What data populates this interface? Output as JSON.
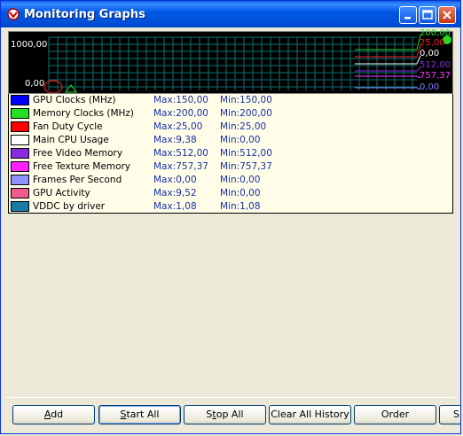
{
  "window": {
    "title": "Monitoring Graphs"
  },
  "graph": {
    "y_max_label": "1000,00",
    "y_min_label": "0,00",
    "right_values": [
      {
        "text": "200,00",
        "color": "#22dd22"
      },
      {
        "text": "25,00",
        "color": "#ff2020"
      },
      {
        "text": "0,00",
        "color": "#ffffff"
      },
      {
        "text": "512,00",
        "color": "#8a2be2"
      },
      {
        "text": "757,37",
        "color": "#ff33ff"
      },
      {
        "text": "0,00",
        "color": "#8080ff"
      }
    ]
  },
  "legend": {
    "rows": [
      {
        "name": "GPU Clocks (MHz)",
        "max": "Max:150,00",
        "min": "Min:150,00",
        "color": "#0000ff"
      },
      {
        "name": "Memory Clocks (MHz)",
        "max": "Max:200,00",
        "min": "Min:200,00",
        "color": "#22e022"
      },
      {
        "name": "Fan Duty Cycle",
        "max": "Max:25,00",
        "min": "Min:25,00",
        "color": "#ff0000"
      },
      {
        "name": "Main CPU Usage",
        "max": "Max:9,38",
        "min": "Min:0,00",
        "color": "#ffffff"
      },
      {
        "name": "Free Video Memory",
        "max": "Max:512,00",
        "min": "Min:512,00",
        "color": "#8a2be2"
      },
      {
        "name": "Free Texture Memory",
        "max": "Max:757,37",
        "min": "Min:757,37",
        "color": "#ff22ff"
      },
      {
        "name": "Frames Per Second",
        "max": "Max:0,00",
        "min": "Min:0,00",
        "color": "#9090ff"
      },
      {
        "name": "GPU Activity",
        "max": "Max:9,52",
        "min": "Min:0,00",
        "color": "#f05a8c"
      },
      {
        "name": "VDDC by driver",
        "max": "Max:1,08",
        "min": "Min:1,08",
        "color": "#1a7aa8"
      }
    ]
  },
  "buttons": {
    "add": {
      "first": "A",
      "rest": "dd"
    },
    "start_all": {
      "first": "S",
      "rest": "tart All"
    },
    "stop_all": {
      "pre": "S",
      "u": "t",
      "rest": "op All"
    },
    "clear_all_history": "Clear All History",
    "order": "Order",
    "partial": "S"
  }
}
